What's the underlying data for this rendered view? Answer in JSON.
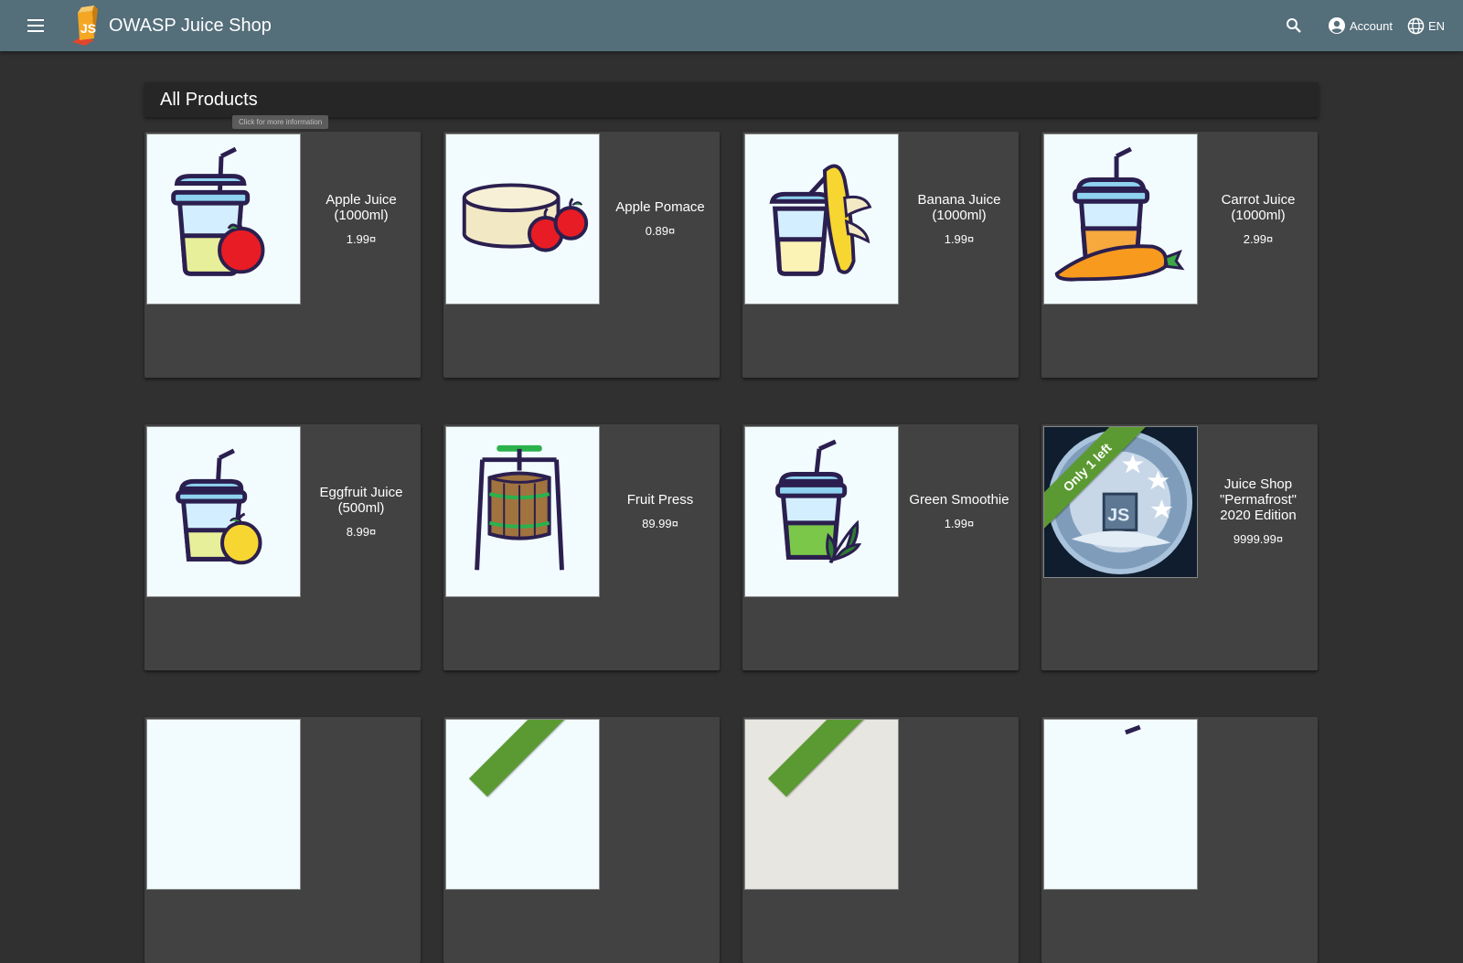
{
  "header": {
    "title": "OWASP Juice Shop",
    "account_label": "Account",
    "language_label": "EN"
  },
  "main": {
    "heading": "All Products",
    "tooltip": "Click for more information"
  },
  "colors": {
    "toolbar": "#546e7a",
    "background": "#303030",
    "card": "#424242",
    "ribbon": "#5b9a32"
  },
  "products": [
    {
      "name": "Apple Juice (1000ml)",
      "price": "1.99¤",
      "image": "apple-juice-icon"
    },
    {
      "name": "Apple Pomace",
      "price": "0.89¤",
      "image": "apple-pomace-icon"
    },
    {
      "name": "Banana Juice (1000ml)",
      "price": "1.99¤",
      "image": "banana-juice-icon"
    },
    {
      "name": "Carrot Juice (1000ml)",
      "price": "2.99¤",
      "image": "carrot-juice-icon"
    },
    {
      "name": "Eggfruit Juice (500ml)",
      "price": "8.99¤",
      "image": "eggfruit-juice-icon"
    },
    {
      "name": "Fruit Press",
      "price": "89.99¤",
      "image": "fruit-press-icon"
    },
    {
      "name": "Green Smoothie",
      "price": "1.99¤",
      "image": "green-smoothie-icon"
    },
    {
      "name": "Juice Shop \"Permafrost\" 2020 Edition",
      "price": "9999.99¤",
      "image": "permafrost-coin-icon",
      "ribbon": "Only 1 left"
    }
  ]
}
